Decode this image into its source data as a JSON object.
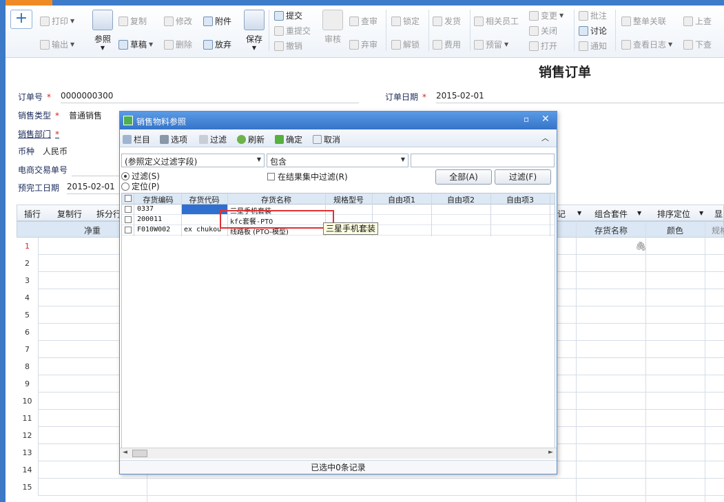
{
  "toolbar": {
    "print": "打印",
    "export": "输出",
    "reference": "参照",
    "copy": "复制",
    "draft": "草稿",
    "modify": "修改",
    "delete": "删除",
    "attach": "附件",
    "abandon": "放弃",
    "save": "保存",
    "submit": "提交",
    "resubmit": "重提交",
    "revoke": "撤销",
    "audit": "审核",
    "review": "查审",
    "abandon_review": "弃审",
    "lock": "锁定",
    "unlock": "解锁",
    "ship": "发货",
    "cost": "费用",
    "related_staff": "相关员工",
    "reserve": "预留",
    "change": "变更",
    "close": "关闭",
    "open": "打开",
    "annotate": "批注",
    "discuss": "讨论",
    "notify": "通知",
    "whole_link": "整单关联",
    "view_log": "查看日志",
    "prev": "上查",
    "next": "下查"
  },
  "page": {
    "title": "销售订单"
  },
  "form": {
    "order_no_label": "订单号",
    "order_no": "0000000300",
    "order_date_label": "订单日期",
    "order_date": "2015-02-01",
    "sales_type_label": "销售类型",
    "sales_type": "普通销售",
    "sales_dept_label": "销售部门",
    "currency_label": "币种",
    "currency": "人民币",
    "ecommerce_no_label": "电商交易单号",
    "expected_date_label": "预完工日期",
    "expected_date": "2015-02-01"
  },
  "grid": {
    "toolbar": {
      "insert_row": "插行",
      "copy_row": "复制行",
      "split_row": "拆分行",
      "mark": "记",
      "combo_kit": "组合套件",
      "sort_locate": "排序定位",
      "display": "显"
    },
    "headers": {
      "net_weight": "净重",
      "inventory_name": "存货名称",
      "color": "颜色",
      "spec": "规格"
    },
    "row_numbers": [
      "1",
      "2",
      "3",
      "4",
      "5",
      "6",
      "7",
      "8",
      "9",
      "10",
      "11",
      "12",
      "13",
      "14",
      "15"
    ]
  },
  "dialog": {
    "title": "销售物料参照",
    "toolbar": {
      "columns": "栏目",
      "options": "选项",
      "filter": "过滤",
      "refresh": "刷新",
      "confirm": "确定",
      "cancel": "取消"
    },
    "filter_field": "(参照定义过滤字段)",
    "filter_op": "包含",
    "filter_value": "",
    "radio_filter": "过滤(S)",
    "radio_locate": "定位(P)",
    "filter_in_result": "在结果集中过滤(R)",
    "btn_all": "全部(A)",
    "btn_filter": "过滤(F)",
    "columns": [
      "存货编码",
      "存货代码",
      "存货名称",
      "规格型号",
      "自由项1",
      "自由项2",
      "自由项3"
    ],
    "rows": [
      {
        "code": "0337",
        "alias": "",
        "name": "三星手机套装"
      },
      {
        "code": "200011",
        "alias": "",
        "name": "kfc套餐-PTO"
      },
      {
        "code": "F010W002",
        "alias": "ex chukou",
        "name": "线路板 (PTO-模型)"
      }
    ],
    "status": "已选中0条记录",
    "tooltip": "三星手机套装"
  },
  "colors": {
    "accent": "#3c79c6",
    "title_bar": "#3574c8",
    "highlight": "#e03030",
    "selected_cell": "#2f6fd0"
  }
}
